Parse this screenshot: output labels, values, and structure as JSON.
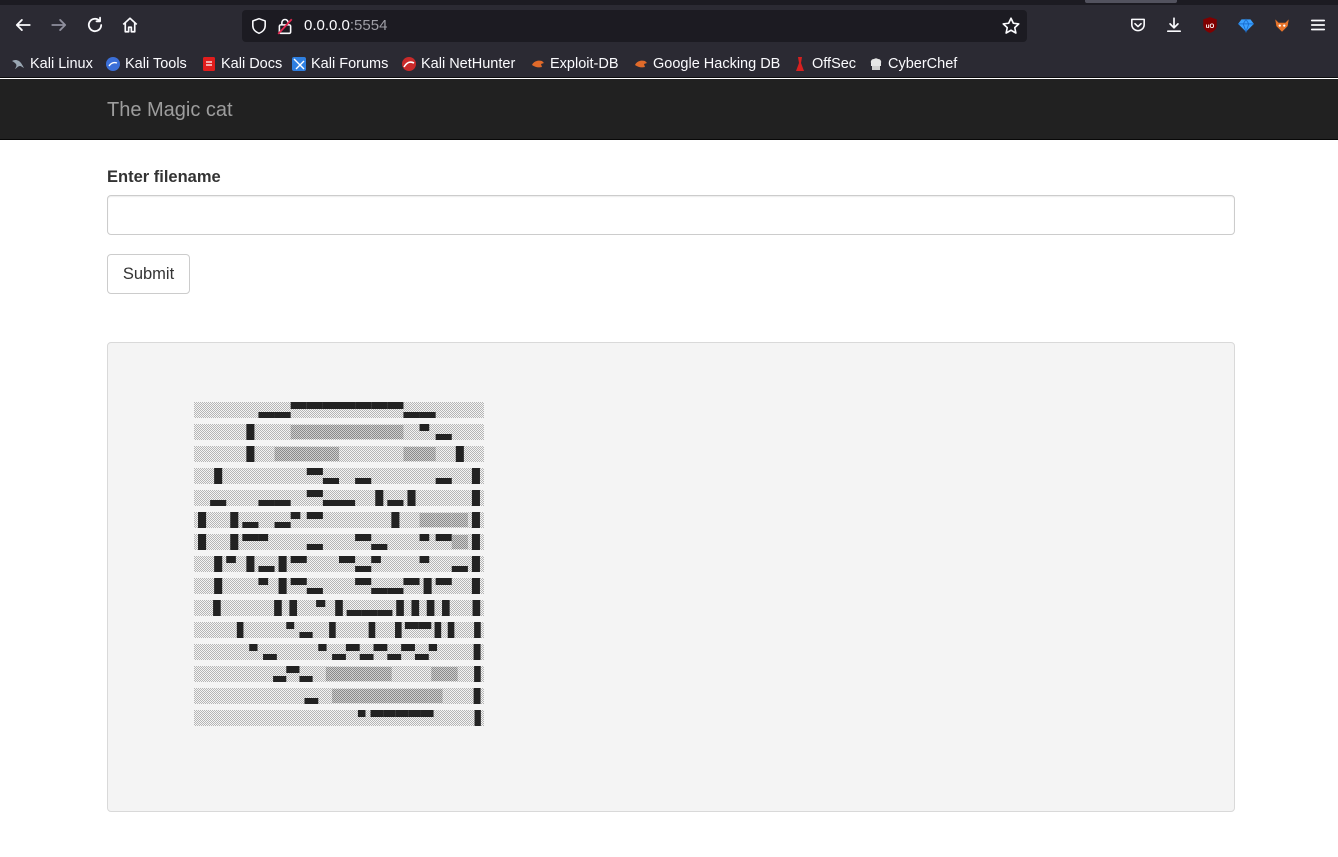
{
  "browser": {
    "url_host": "0.0.0.0",
    "url_port": ":5554",
    "bookmarks": [
      {
        "label": "Kali Linux",
        "icon": "kali-dragon-icon",
        "color": "#6f8fb0"
      },
      {
        "label": "Kali Tools",
        "icon": "kali-tools-icon",
        "color": "#3b82f6"
      },
      {
        "label": "Kali Docs",
        "icon": "kali-docs-icon",
        "color": "#e11d1d"
      },
      {
        "label": "Kali Forums",
        "icon": "kali-forums-icon",
        "color": "#2f7fe0"
      },
      {
        "label": "Kali NetHunter",
        "icon": "kali-nethunter-icon",
        "color": "#d02525"
      },
      {
        "label": "Exploit-DB",
        "icon": "exploit-db-icon",
        "color": "#e06a2a"
      },
      {
        "label": "Google Hacking DB",
        "icon": "ghdb-icon",
        "color": "#e06a2a"
      },
      {
        "label": "OffSec",
        "icon": "offsec-icon",
        "color": "#d62020"
      },
      {
        "label": "CyberChef",
        "icon": "cyberchef-icon",
        "color": "#d8d8d8"
      }
    ]
  },
  "navbar": {
    "brand": "The Magic cat"
  },
  "form": {
    "label": "Enter filename",
    "input_value": "",
    "input_placeholder": "",
    "submit_label": "Submit"
  },
  "output": {
    "art_description_icon": "ascii-cat-art"
  },
  "colors": {
    "navbar_bg": "#212121",
    "brand_text": "#9d9d9d",
    "well_bg": "#f4f4f4",
    "browser_chrome": "#2b2a33"
  }
}
